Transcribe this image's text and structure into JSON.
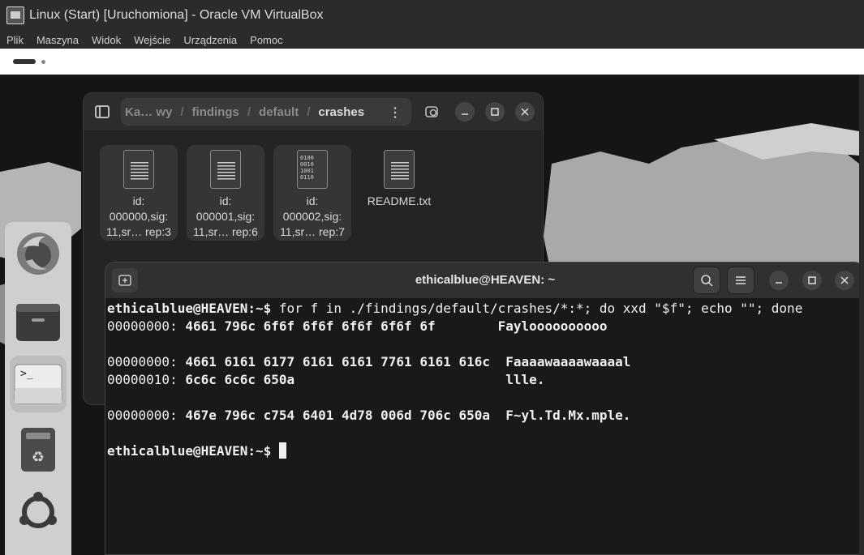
{
  "vbox": {
    "title": "Linux (Start) [Uruchomiona] - Oracle VM VirtualBox",
    "menu": [
      "Plik",
      "Maszyna",
      "Widok",
      "Wejście",
      "Urządzenia",
      "Pomoc"
    ]
  },
  "dock": {
    "items": [
      "firefox-icon",
      "files-icon",
      "terminal-icon",
      "trash-icon",
      "ubuntu-apps-icon"
    ],
    "terminal_glyph": ">_"
  },
  "files": {
    "breadcrumbs": [
      "Ka… wy",
      "findings",
      "default",
      "crashes"
    ],
    "path_menu": "⋮",
    "items": [
      {
        "line1": "id:",
        "line2": "000000,sig:",
        "line3": "11,sr… rep:3"
      },
      {
        "line1": "id:",
        "line2": "000001,sig:",
        "line3": "11,sr… rep:6"
      },
      {
        "line1": "id:",
        "line2": "000002,sig:",
        "line3": "11,sr… rep:7",
        "binary": "0100\n0010\n1001\n0110"
      },
      {
        "line1": "README.txt"
      }
    ]
  },
  "terminal": {
    "title": "ethicalblue@HEAVEN: ~",
    "prompt": "ethicalblue@HEAVEN:~$ ",
    "command": "for f in ./findings/default/crashes/*:*; do xxd \"$f\"; echo \"\"; done",
    "output": [
      {
        "offset": "00000000: ",
        "hex": "4661 796c 6f6f 6f6f 6f6f 6f6f 6f        ",
        "ascii": "Fayloooooooooo"
      },
      {
        "offset": "00000000: ",
        "hex": "4661 6161 6177 6161 6161 7761 6161 616c  ",
        "ascii": "Faaaawaaaawaaaal"
      },
      {
        "offset": "00000010: ",
        "hex": "6c6c 6c6c 650a                           ",
        "ascii": "llle."
      },
      {
        "offset": "00000000: ",
        "hex": "467e 796c c754 6401 4d78 006d 706c 650a  ",
        "ascii": "F~yl.Td.Mx.mple."
      }
    ]
  }
}
